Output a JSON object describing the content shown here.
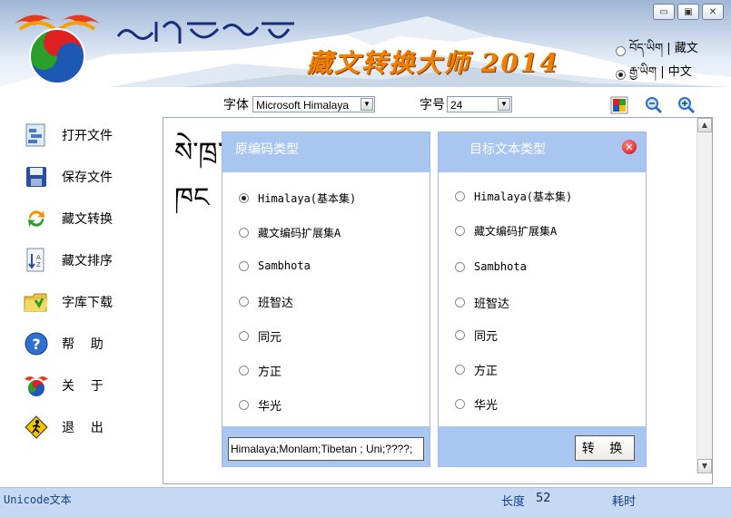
{
  "window": {
    "title": "藏文转换大师 2014",
    "title_script": "ཀུན་མཁྱེན་རྣམ་བྱེད་",
    "buttons": {
      "minimize": "▭",
      "restore": "▣",
      "close": "✕"
    }
  },
  "language": {
    "options": [
      {
        "label": "བོད་ཡིག | 藏文",
        "selected": false
      },
      {
        "label": "རྒྱ་ཡིག | 中文",
        "selected": true
      }
    ]
  },
  "toolbar": {
    "font_label": "字体",
    "font_value": "Microsoft Himalaya",
    "size_label": "字号",
    "size_value": "24"
  },
  "sidebar": {
    "items": [
      {
        "label": "打开文件",
        "icon": "open-file-icon"
      },
      {
        "label": "保存文件",
        "icon": "save-icon"
      },
      {
        "label": "藏文转换",
        "icon": "convert-icon"
      },
      {
        "label": "藏文排序",
        "icon": "sort-icon"
      },
      {
        "label": "字库下载",
        "icon": "folder-download-icon"
      },
      {
        "label": "帮    助",
        "icon": "help-icon"
      },
      {
        "label": "关    于",
        "icon": "about-icon"
      },
      {
        "label": "退    出",
        "icon": "exit-icon"
      }
    ]
  },
  "editor": {
    "text_line1": "སེ་ཁྲ༑ ༑ ༑ ༑ ༑ ༑ ༑ ༑ ༑ ༑ ༑ ་ཀླན",
    "text_line2": "ཁང"
  },
  "source_panel": {
    "title": "原编码类型",
    "options": [
      {
        "label": "Himalaya(基本集)",
        "selected": true
      },
      {
        "label": "藏文编码扩展集A",
        "selected": false
      },
      {
        "label": "Sambhota",
        "selected": false
      },
      {
        "label": "班智达",
        "selected": false
      },
      {
        "label": "同元",
        "selected": false
      },
      {
        "label": "方正",
        "selected": false
      },
      {
        "label": "华光",
        "selected": false
      }
    ],
    "input_value": "Himalaya;Monlam;Tibetan ; Uni;????;"
  },
  "target_panel": {
    "title": "目标文本类型",
    "options": [
      {
        "label": "Himalaya(基本集)",
        "selected": false
      },
      {
        "label": "藏文编码扩展集A",
        "selected": false
      },
      {
        "label": "Sambhota",
        "selected": false
      },
      {
        "label": "班智达",
        "selected": false
      },
      {
        "label": "同元",
        "selected": false
      },
      {
        "label": "方正",
        "selected": false
      },
      {
        "label": "华光",
        "selected": false
      }
    ],
    "convert_label": "转 换"
  },
  "status": {
    "encoding": "Unicode文本",
    "length_label": "长度",
    "length_value": "52",
    "time_label": "耗时"
  },
  "colors": {
    "title_orange": "#f08000",
    "panel_blue": "#a9c6f0",
    "status_blue": "#c6d9f3",
    "status_text": "#14408a"
  }
}
